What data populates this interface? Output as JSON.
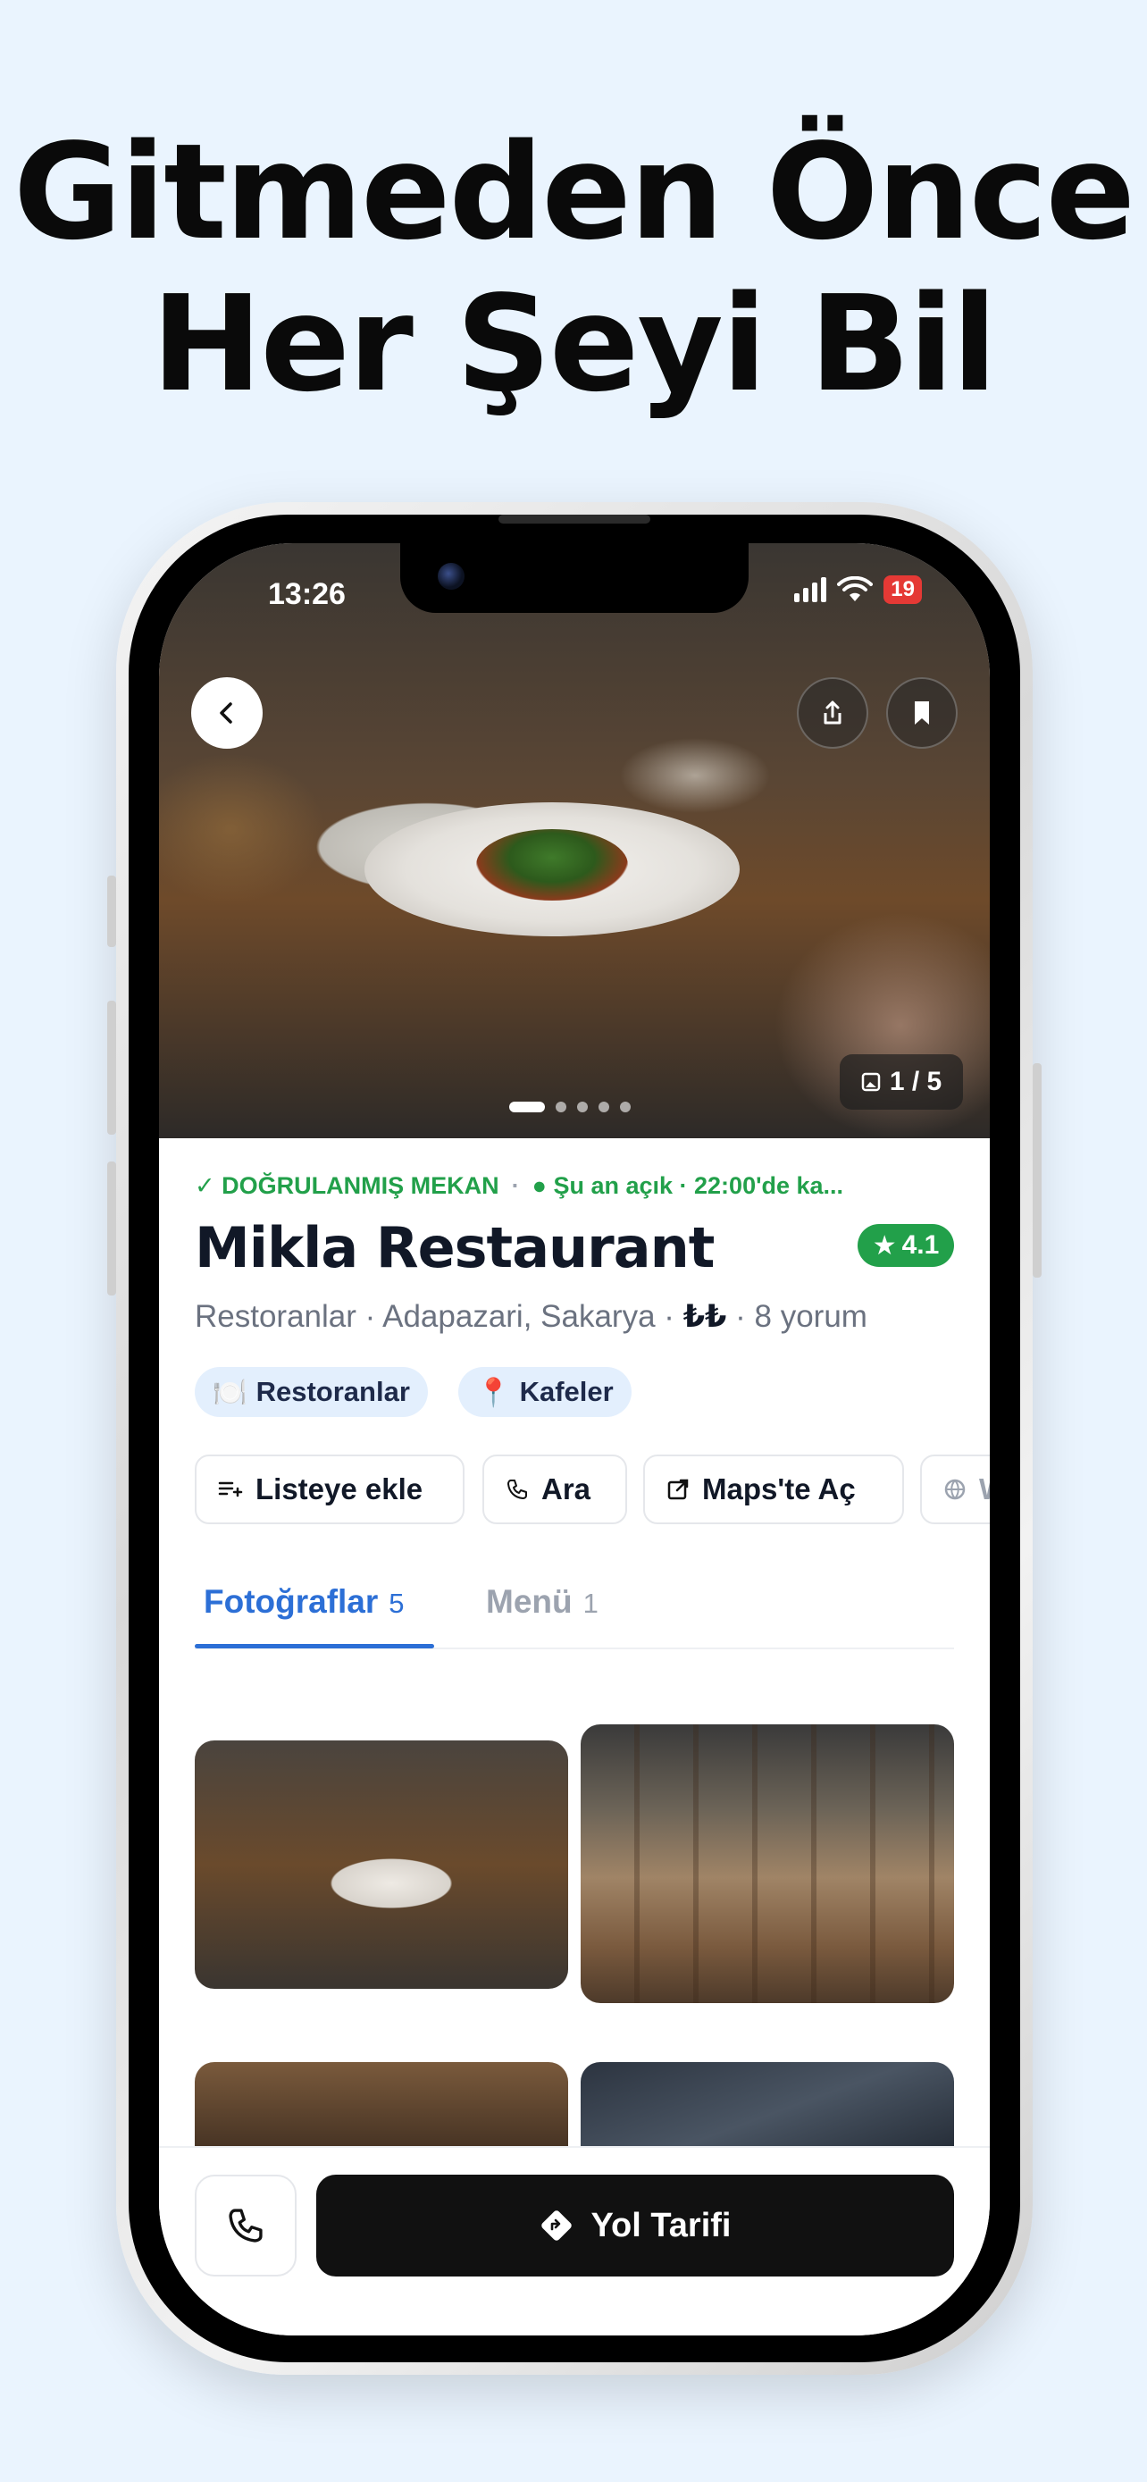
{
  "headline": {
    "line1": "Gitmeden Önce",
    "line2": "Her Şeyi Bil"
  },
  "status_bar": {
    "time": "13:26",
    "battery": "19"
  },
  "hero": {
    "photo_counter": "1 / 5",
    "dots_total": 5,
    "dots_active": 1
  },
  "place": {
    "verified_label": "DOĞRULANMIŞ MEKAN",
    "separator": "·",
    "open_status": "Şu an açık · 22:00'de ka...",
    "name": "Mikla Restaurant",
    "rating": "4.1",
    "category": "Restoranlar",
    "location": "Adapazari, Sakarya",
    "price": "₺₺",
    "reviews": "8 yorum"
  },
  "chips": [
    {
      "icon": "🍽️",
      "label": "Restoranlar"
    },
    {
      "icon": "📍",
      "label": "Kafeler"
    }
  ],
  "actions": {
    "add_to_list": "Listeye ekle",
    "call": "Ara",
    "open_maps": "Maps'te Aç",
    "website": "W"
  },
  "tabs": [
    {
      "label": "Fotoğraflar",
      "count": "5"
    },
    {
      "label": "Menü",
      "count": "1"
    }
  ],
  "bottom": {
    "directions": "Yol Tarifi"
  },
  "icons": {
    "back": "chevron-left-icon",
    "share": "share-icon",
    "save": "bookmark-icon",
    "phone": "phone-icon",
    "directions": "directions-icon"
  },
  "colors": {
    "background": "#eaf4fe",
    "accent_green": "#22a04a",
    "accent_blue": "#2c6fd6",
    "chip_bg": "#e3effd",
    "primary_button": "#111111"
  }
}
